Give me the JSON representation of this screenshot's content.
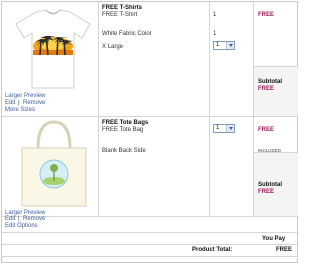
{
  "items": [
    {
      "group": "FREE T-Shirts",
      "product": "FREE T-Shirt",
      "color": "White Fabric Color",
      "size": "X Large",
      "qty_display": "1",
      "color_qty": "1",
      "select_value": "1",
      "price": "FREE",
      "subtotal_label": "Subtotal",
      "subtotal_value": "FREE",
      "links": [
        "Larger Preview",
        "Edit",
        "|",
        "Remove",
        "More Sizes"
      ],
      "thumb_icon": "tshirt-palm-trees-icon"
    },
    {
      "group": "FREE Tote Bags",
      "product": "FREE Tote Bag",
      "side": "Blank Back Side",
      "select_value": "1",
      "price": "FREE",
      "included": "INCLUDED",
      "subtotal_label": "Subtotal",
      "subtotal_value": "FREE",
      "links": [
        "Larger Preview",
        "Edit",
        "|",
        "Remove",
        "Edit Options"
      ],
      "thumb_icon": "tote-bag-icon"
    }
  ],
  "footer": {
    "you_pay": "You Pay",
    "product_total_label": "Product Total:",
    "product_total_value": "FREE"
  },
  "colors": {
    "accent": "#9b1c5a",
    "link": "#3a5f9a",
    "border": "#d6d6d6"
  }
}
